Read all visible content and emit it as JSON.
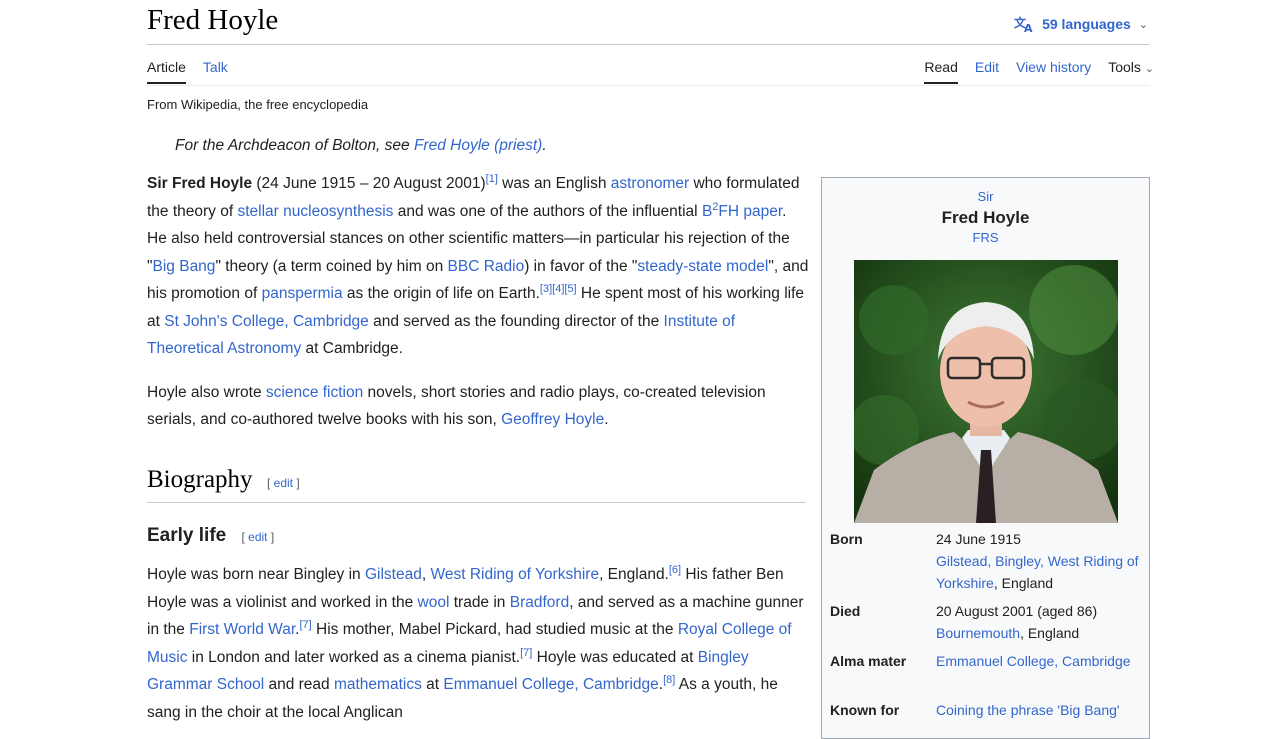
{
  "header": {
    "title": "Fred Hoyle",
    "languages": "59 languages",
    "tabs_left": [
      "Article",
      "Talk"
    ],
    "tabs_right": [
      "Read",
      "Edit",
      "View history",
      "Tools"
    ]
  },
  "tagline": "From Wikipedia, the free encyclopedia",
  "hatnote": {
    "prefix": "For the Archdeacon of Bolton, see ",
    "link": "Fred Hoyle (priest)",
    "suffix": "."
  },
  "infobox": {
    "honorific_prefix": "Sir",
    "name": "Fred Hoyle",
    "honorific_suffix": "FRS",
    "born_label": "Born",
    "born_date": "24 June 1915",
    "born_place_link": "Gilstead, Bingley, West Riding of Yorkshire",
    "born_place_suffix": ", England",
    "died_label": "Died",
    "died_date": "20 August 2001 (aged 86)",
    "died_place_link": "Bournemouth",
    "died_place_suffix": ", England",
    "alma_label": "Alma mater",
    "alma_value": "Emmanuel College, Cambridge",
    "known_label": "Known for",
    "known_value": "Coining the phrase 'Big Bang'"
  },
  "sections": {
    "biography": "Biography",
    "early_life": "Early life",
    "edit": "edit"
  }
}
